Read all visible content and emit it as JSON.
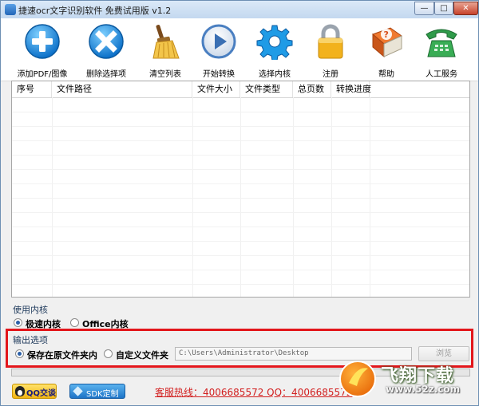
{
  "window": {
    "title": "捷速ocr文字识别软件 免费试用版 v1.2",
    "controls": {
      "minimize": "—",
      "maximize": "□",
      "close": "✕"
    }
  },
  "toolbar": {
    "items": [
      {
        "label": "添加PDF/图像",
        "icon": "add-icon",
        "color": "#1f8ee0"
      },
      {
        "label": "删除选择项",
        "icon": "delete-icon",
        "color": "#1f8ee0"
      },
      {
        "label": "清空列表",
        "icon": "broom-icon",
        "color": "#e0a51f"
      },
      {
        "label": "开始转换",
        "icon": "play-icon",
        "color": "#4a7fc1"
      },
      {
        "label": "选择内核",
        "icon": "gear-icon",
        "color": "#1f8ee0"
      },
      {
        "label": "注册",
        "icon": "lock-icon",
        "color": "#f0b21c"
      },
      {
        "label": "帮助",
        "icon": "help-book-icon",
        "color": "#d9501c"
      },
      {
        "label": "人工服务",
        "icon": "phone-icon",
        "color": "#2f9b4a"
      }
    ]
  },
  "file_list": {
    "columns": [
      "序号",
      "文件路径",
      "文件大小",
      "文件类型",
      "总页数",
      "转换进度"
    ],
    "rows": []
  },
  "engine": {
    "label": "使用内核",
    "options": [
      {
        "label": "极速内核",
        "selected": true
      },
      {
        "label": "Office内核",
        "selected": false
      }
    ]
  },
  "output": {
    "label": "输出选项",
    "options": [
      {
        "label": "保存在原文件夹内",
        "selected": true
      },
      {
        "label": "自定义文件夹",
        "selected": false
      }
    ],
    "path_value": "C:\\Users\\Administrator\\Desktop",
    "browse_label": "浏览"
  },
  "progress": {
    "value": 0
  },
  "footer": {
    "qq_label": "QQ交谈",
    "sdk_label": "SDK定制",
    "hotline": "客服热线：4006685572 QQ：4006685572"
  },
  "watermark": {
    "text": "飞翔下载",
    "url": "www.52z.com"
  }
}
